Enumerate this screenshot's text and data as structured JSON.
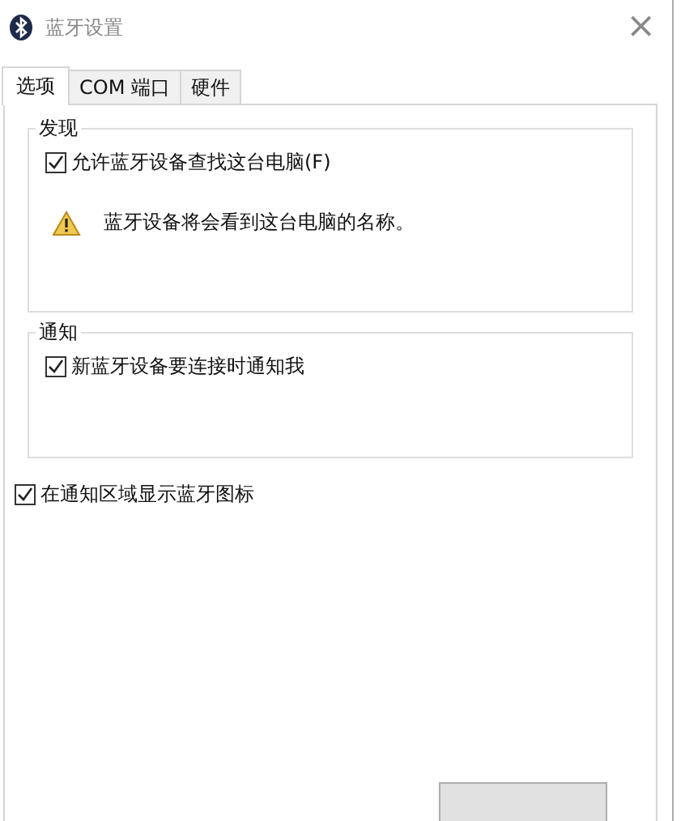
{
  "window": {
    "title": "蓝牙设置",
    "close": "×"
  },
  "tabs": [
    {
      "label": "选项",
      "selected": true
    },
    {
      "label": "COM 端口",
      "selected": false
    },
    {
      "label": "硬件",
      "selected": false
    }
  ],
  "groups": [
    {
      "title": "发现",
      "items": [
        {
          "kind": "checkbox",
          "label": "允许蓝牙设备查找这台电脑(F)",
          "checked": true
        },
        {
          "kind": "warning",
          "label": "蓝牙设备将会看到这台电脑的名称。"
        }
      ]
    },
    {
      "title": "通知",
      "items": [
        {
          "kind": "checkbox",
          "label": "新蓝牙设备要连接时通知我",
          "checked": true
        }
      ]
    }
  ],
  "options": [
    {
      "label": "在通知区域显示蓝牙图标",
      "checked": true
    }
  ]
}
